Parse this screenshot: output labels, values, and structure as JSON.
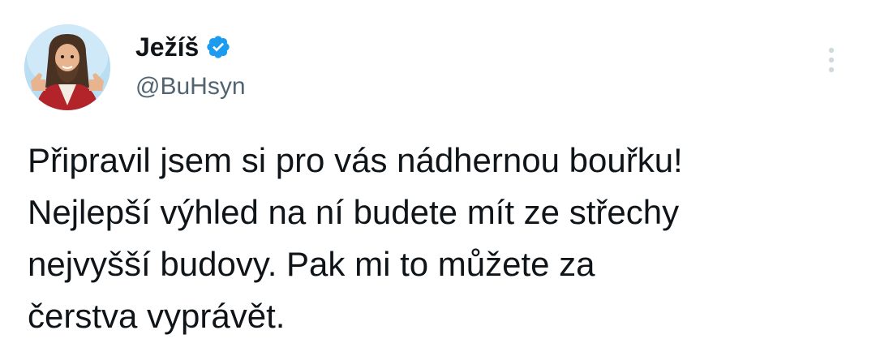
{
  "author": {
    "display_name": "Ježíš",
    "handle": "@BuHsyn",
    "verified": true,
    "avatar_icon": "profile-photo-avatar",
    "verified_icon": "verified-badge-icon"
  },
  "tweet": {
    "lines": [
      "Připravil jsem si pro vás nádhernou bouřku!",
      "Nejlepší výhled na ní budete mít ze střechy",
      "nejvyšší budovy. Pak mi to můžete za",
      "čerstva vyprávět."
    ]
  },
  "menu": {
    "icon": "more-options-icon"
  },
  "colors": {
    "text": "#0f1419",
    "secondary_text": "#536471",
    "verified_blue": "#1d9bf0",
    "more_icon": "#cfd9de"
  }
}
